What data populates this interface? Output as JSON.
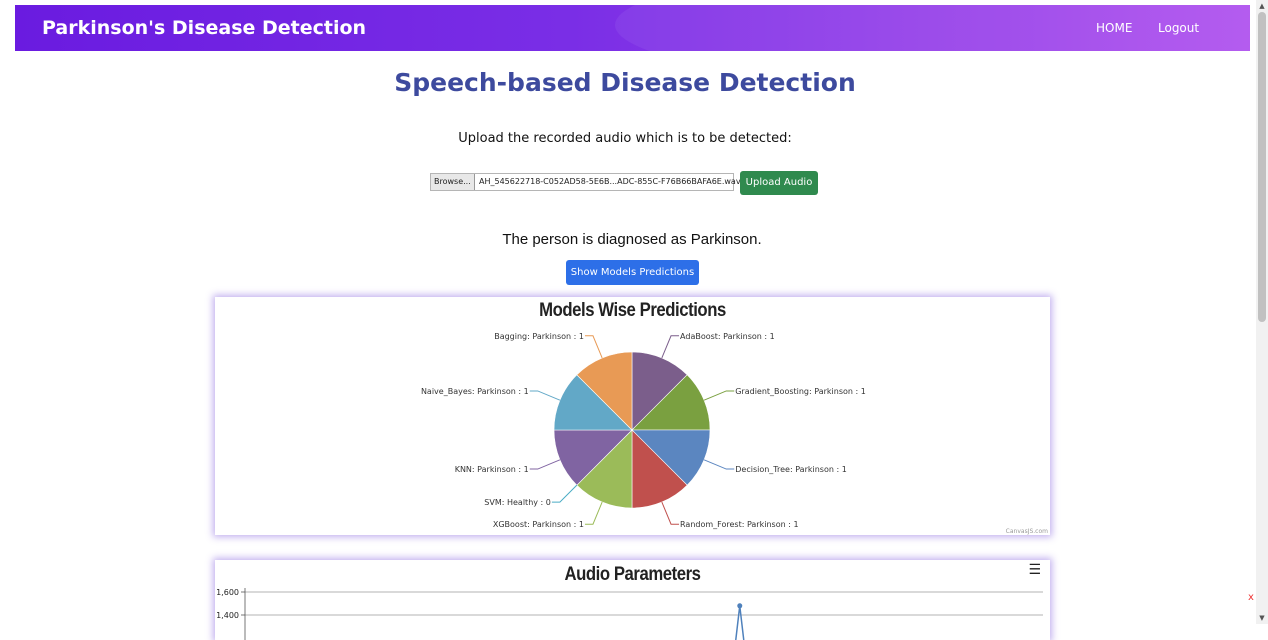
{
  "navbar": {
    "brand": "Parkinson's Disease Detection",
    "links": [
      "HOME",
      "Logout"
    ]
  },
  "page": {
    "title": "Speech-based Disease Detection",
    "upload_label": "Upload the recorded audio which is to be detected:",
    "browse_label": "Browse...",
    "file_name": "AH_545622718-C052AD58-5E6B...ADC-855C-F76B66BAFA6E.wav",
    "upload_button": "Upload Audio",
    "diagnosis": "The person is diagnosed as Parkinson.",
    "show_button": "Show Models Predictions",
    "close_label": "x"
  },
  "chart_data": [
    {
      "type": "pie",
      "title": "Models Wise Predictions",
      "credit": "CanvasJS.com",
      "slices": [
        {
          "label": "AdaBoost: Parkinson : 1",
          "value": 1,
          "color": "#7b5e8b"
        },
        {
          "label": "Gradient_Boosting: Parkinson : 1",
          "value": 1,
          "color": "#7aa040"
        },
        {
          "label": "Decision_Tree: Parkinson : 1",
          "value": 1,
          "color": "#5b86c0"
        },
        {
          "label": "Random_Forest: Parkinson : 1",
          "value": 1,
          "color": "#c0504d"
        },
        {
          "label": "XGBoost: Parkinson : 1",
          "value": 1,
          "color": "#9bbb59"
        },
        {
          "label": "SVM: Healthy : 0",
          "value": 0,
          "color": "#4aacc5"
        },
        {
          "label": "KNN: Parkinson : 1",
          "value": 1,
          "color": "#8064a2"
        },
        {
          "label": "Naive_Bayes: Parkinson : 1",
          "value": 1,
          "color": "#62a8c7"
        },
        {
          "label": "Bagging: Parkinson : 1",
          "value": 1,
          "color": "#e89a55"
        }
      ]
    },
    {
      "type": "line",
      "title": "Audio Parameters",
      "menu_icon": "menu-icon",
      "y_ticks": [
        "1,600",
        "1,400"
      ],
      "ylim": [
        1300,
        1600
      ],
      "visible_points": [
        {
          "x": 0.62,
          "y": 1480
        }
      ]
    }
  ]
}
